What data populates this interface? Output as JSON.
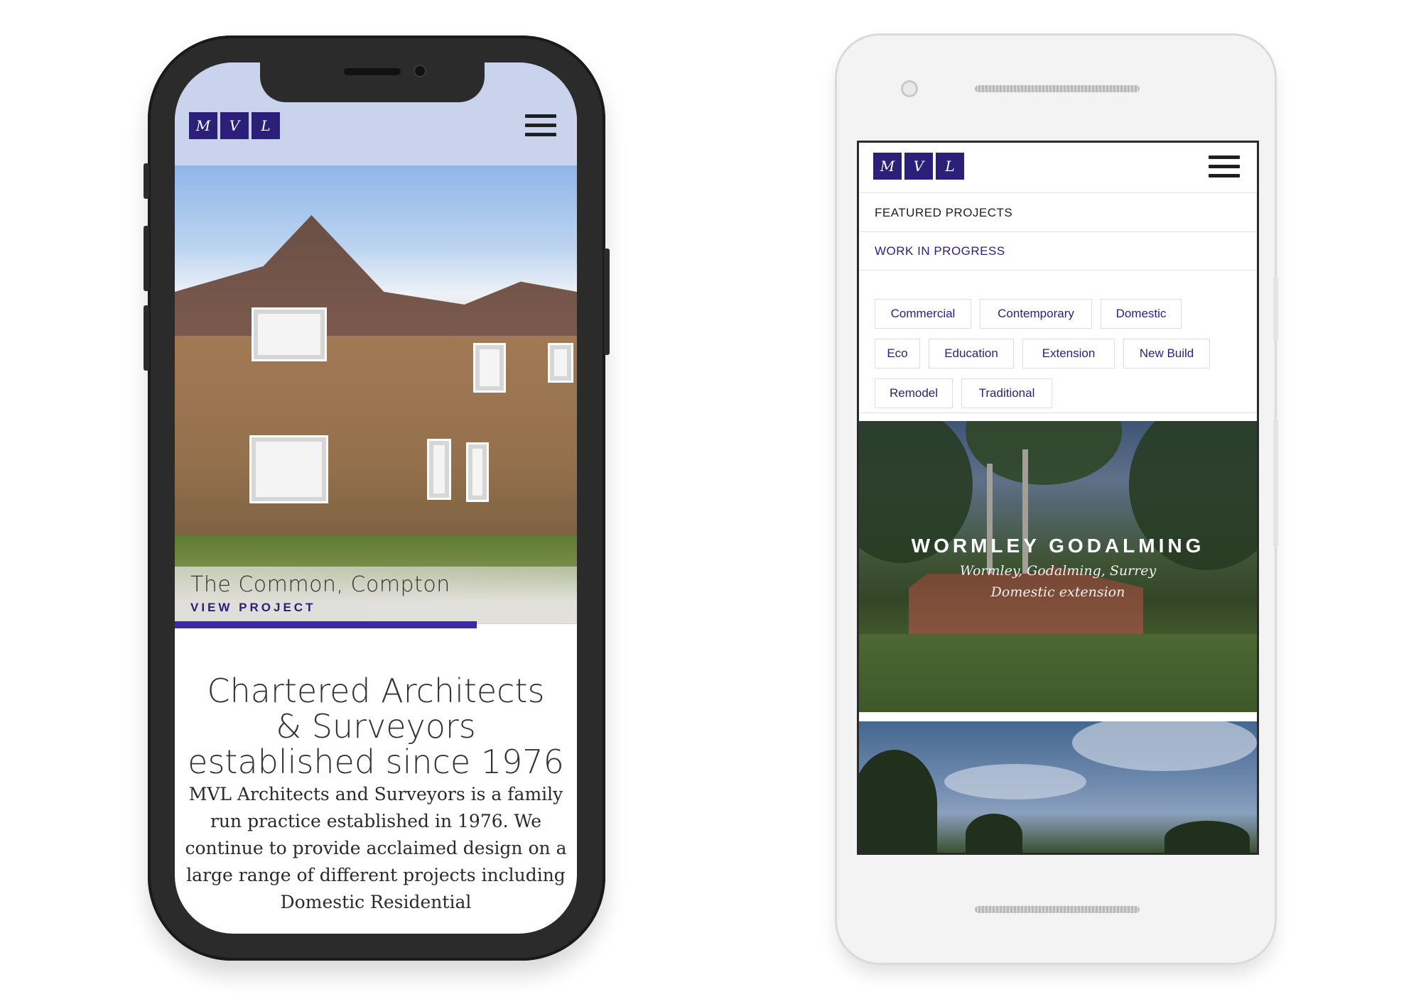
{
  "phone1": {
    "logo_letters": [
      "M",
      "V",
      "L"
    ],
    "hero": {
      "project_title": "The Common, Compton",
      "link_label": "VIEW PROJECT",
      "slide_progress": 0.75
    },
    "tagline": "Chartered Architects\n& Surveyors\nestablished since 1976",
    "intro": "MVL Architects and Surveyors is a family run practice established in 1976.  We continue to provide acclaimed design on a large range of different projects including Domestic Residential"
  },
  "phone2": {
    "logo_letters": [
      "M",
      "V",
      "L"
    ],
    "menu": [
      {
        "label": "FEATURED PROJECTS",
        "color": "#1f1f1f"
      },
      {
        "label": "WORK IN PROGRESS",
        "color": "#2c1f7a"
      }
    ],
    "tags": [
      "Commercial",
      "Contemporary",
      "Domestic",
      "Eco",
      "Education",
      "Extension",
      "New Build",
      "Remodel",
      "Traditional"
    ],
    "feature": {
      "title": "WORMLEY GODALMING",
      "location": "Wormley, Godalming, Surrey",
      "type": "Domestic extension"
    }
  },
  "colors": {
    "brand": "#2c1f7a",
    "accent_bar": "#3a2aa6"
  },
  "icons": [
    "hamburger-menu-icon",
    "hamburger-menu-icon"
  ]
}
